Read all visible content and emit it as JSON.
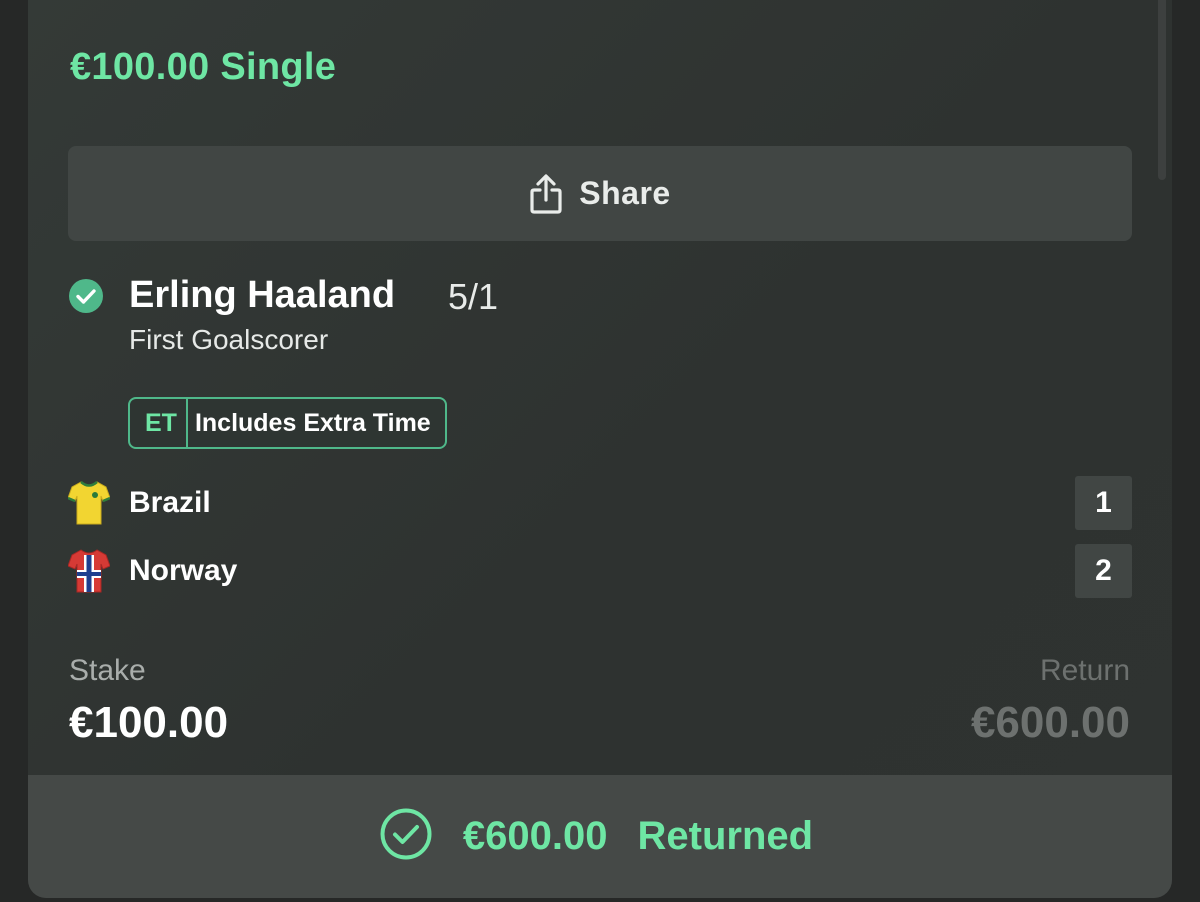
{
  "bet": {
    "title": "€100.00 Single",
    "share_label": "Share"
  },
  "selection": {
    "name": "Erling Haaland",
    "odds": "5/1",
    "market": "First Goalscorer",
    "badge_code": "ET",
    "badge_text": "Includes Extra Time"
  },
  "teams": [
    {
      "name": "Brazil",
      "score": "1"
    },
    {
      "name": "Norway",
      "score": "2"
    }
  ],
  "summary": {
    "stake_label": "Stake",
    "stake_value": "€100.00",
    "return_label": "Return",
    "return_value": "€600.00"
  },
  "footer": {
    "amount": "€600.00",
    "status": "Returned"
  },
  "colors": {
    "accent_green": "#6ee6a4",
    "background": "#262827",
    "card": "#323735"
  },
  "icons": {
    "share": "share-icon",
    "check": "check-circle-icon",
    "brazil": "brazil-shirt-icon",
    "norway": "norway-shirt-icon"
  }
}
